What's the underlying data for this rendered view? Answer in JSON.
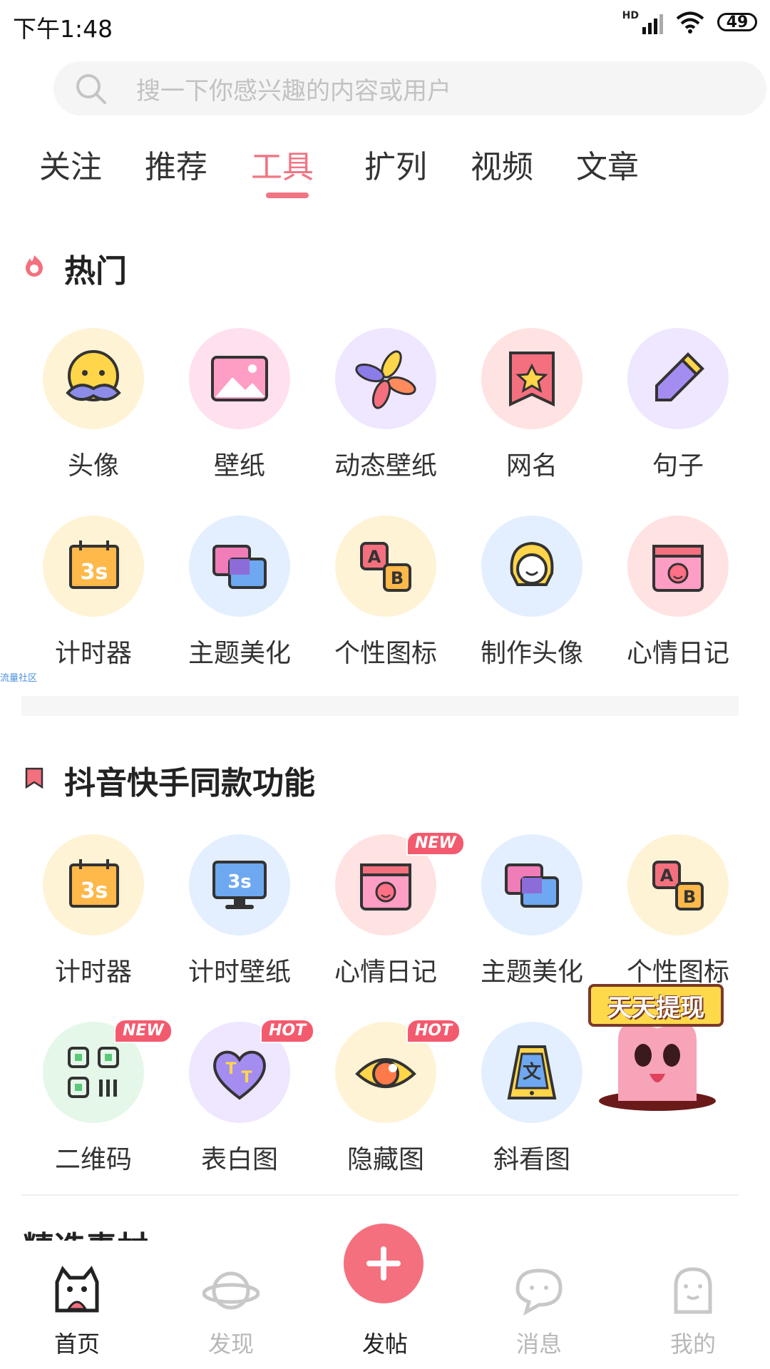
{
  "status_bar": {
    "time": "下午1:48",
    "network": "HD",
    "battery": "49"
  },
  "search": {
    "placeholder": "搜一下你感兴趣的内容或用户"
  },
  "tabs": [
    {
      "label": "关注"
    },
    {
      "label": "推荐"
    },
    {
      "label": "工具",
      "active": true
    },
    {
      "label": "扩列"
    },
    {
      "label": "视频"
    },
    {
      "label": "文章"
    }
  ],
  "hot": {
    "title": "热门",
    "items": [
      {
        "label": "头像",
        "icon": "mustache-face-icon"
      },
      {
        "label": "壁纸",
        "icon": "picture-icon"
      },
      {
        "label": "动态壁纸",
        "icon": "pinwheel-icon"
      },
      {
        "label": "网名",
        "icon": "star-bookmark-icon"
      },
      {
        "label": "句子",
        "icon": "pencil-icon"
      },
      {
        "label": "计时器",
        "icon": "calendar-3s-icon"
      },
      {
        "label": "主题美化",
        "icon": "overlapping-cards-icon"
      },
      {
        "label": "个性图标",
        "icon": "ab-swap-icon"
      },
      {
        "label": "制作头像",
        "icon": "girl-face-icon"
      },
      {
        "label": "心情日记",
        "icon": "mood-calendar-icon"
      }
    ]
  },
  "watermark": "流量社区",
  "douyin": {
    "title": "抖音快手同款功能",
    "items": [
      {
        "label": "计时器",
        "icon": "calendar-3s-icon"
      },
      {
        "label": "计时壁纸",
        "icon": "monitor-3s-icon"
      },
      {
        "label": "心情日记",
        "icon": "mood-calendar-icon",
        "badge": "NEW"
      },
      {
        "label": "主题美化",
        "icon": "overlapping-cards-icon"
      },
      {
        "label": "个性图标",
        "icon": "ab-swap-icon"
      },
      {
        "label": "二维码",
        "icon": "qr-code-icon",
        "badge": "NEW"
      },
      {
        "label": "表白图",
        "icon": "tt-heart-icon",
        "badge": "HOT"
      },
      {
        "label": "隐藏图",
        "icon": "eye-icon",
        "badge": "HOT"
      },
      {
        "label": "斜看图",
        "icon": "phone-wen-icon"
      }
    ]
  },
  "promo": {
    "label": "天天提现"
  },
  "next_section": {
    "title": "精选素材"
  },
  "bottom_nav": [
    {
      "label": "首页",
      "icon": "home-mascot-icon",
      "active": true
    },
    {
      "label": "发现",
      "icon": "planet-icon"
    },
    {
      "label": "发帖",
      "icon": "plus-icon"
    },
    {
      "label": "消息",
      "icon": "chat-bubble-icon"
    },
    {
      "label": "我的",
      "icon": "profile-ghost-icon"
    }
  ],
  "colors": {
    "accent": "#f07684",
    "badge": "#f45a6e"
  }
}
